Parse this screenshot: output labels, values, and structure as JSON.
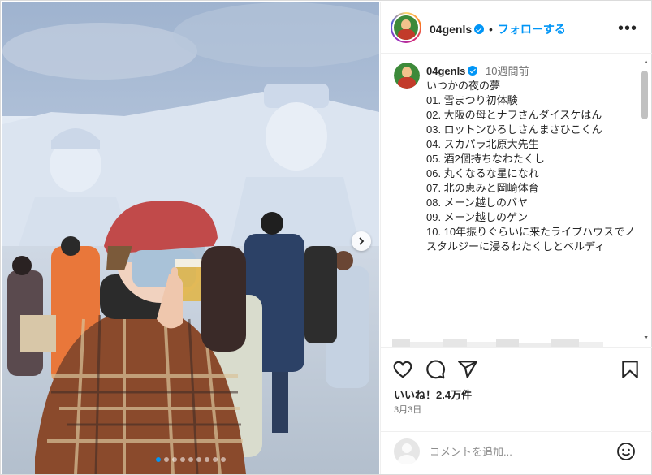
{
  "post": {
    "username": "04genls",
    "follow_label": "フォローする",
    "separator": "•",
    "more_label": "•••"
  },
  "caption": {
    "username": "04genls",
    "time_ago": "10週間前",
    "lines": [
      "いつかの夜の夢",
      "01. 雪まつり初体験",
      "02. 大阪の母とナヲさんダイスケはん",
      "03. ロットンひろしさんまさひこくん",
      "04. スカパラ北原大先生",
      "05. 酒2個持ちなわたくし",
      "06. 丸くなるな星になれ",
      "07. 北の恵みと岡崎体育",
      "08. メーン越しのバヤ",
      "09. メーン越しのゲン",
      "10. 10年振りぐらいに来たライブハウスでノスタルジーに浸るわたくしとベルディ"
    ]
  },
  "engagement": {
    "likes": "いいね！2.4万件",
    "date": "3月3日"
  },
  "comment": {
    "placeholder": "コメントを追加..."
  },
  "carousel": {
    "count": 9,
    "active_index": 0
  },
  "icons": {
    "like": "heart-icon",
    "comment": "comment-icon",
    "share": "send-icon",
    "save": "bookmark-icon",
    "emoji": "emoji-icon",
    "next": "chevron-right-icon"
  },
  "colors": {
    "accent": "#0095f6",
    "text": "#262626",
    "secondary": "#737373",
    "border": "#dbdbdb"
  }
}
